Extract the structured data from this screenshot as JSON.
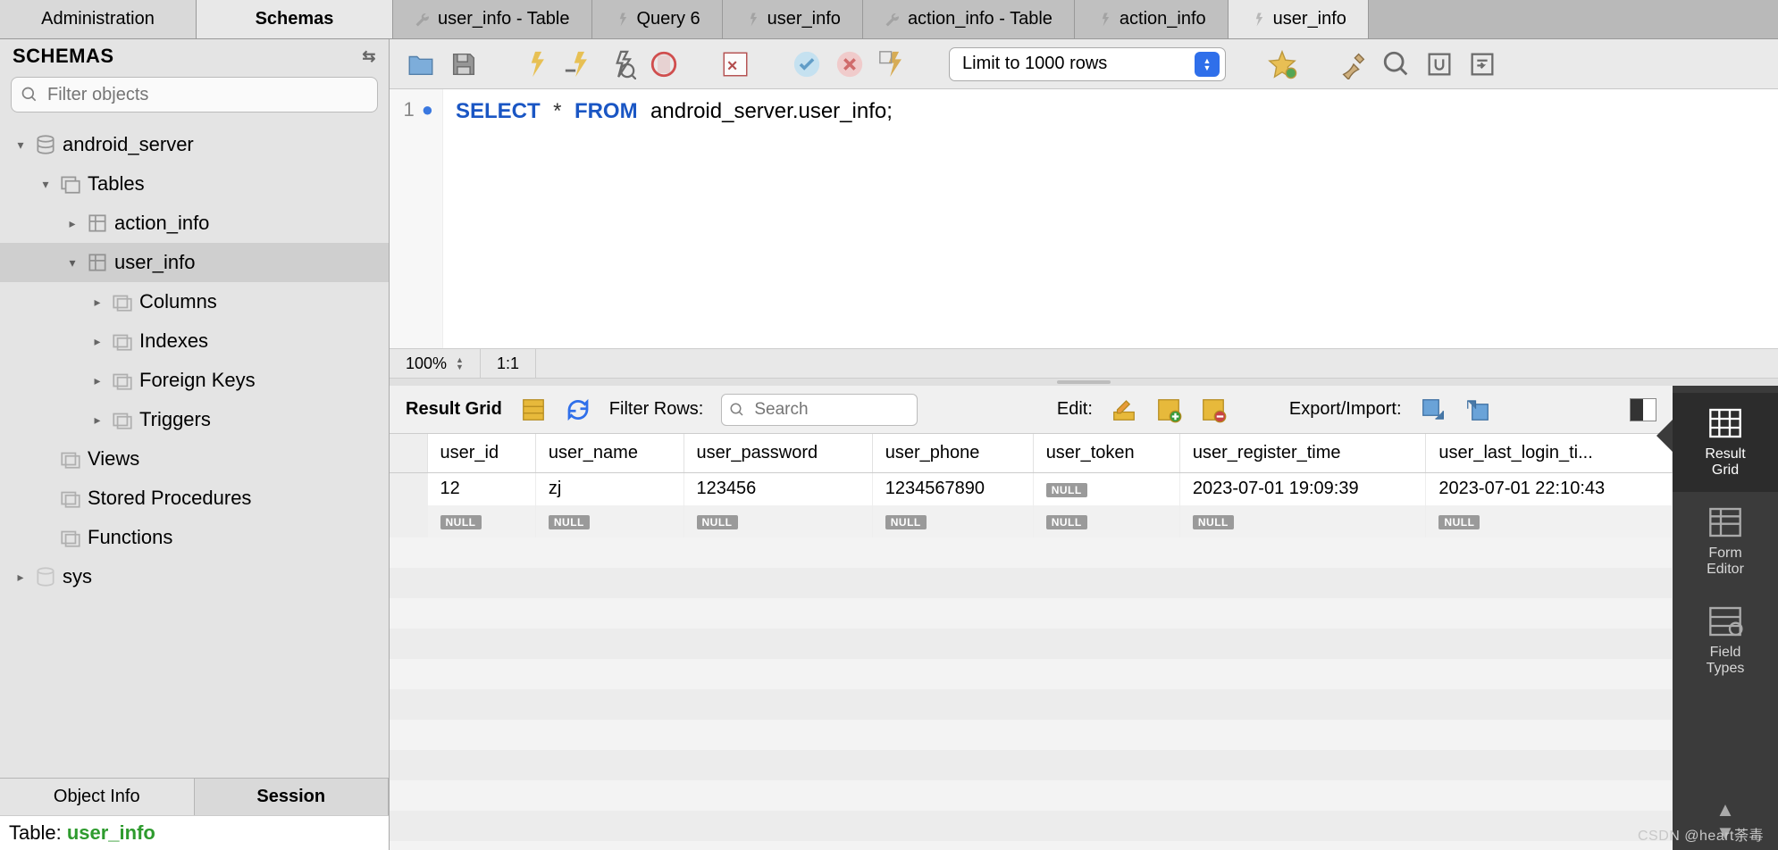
{
  "top": {
    "tabs_left": [
      "Administration",
      "Schemas"
    ],
    "active_left": 1,
    "editor_tabs": [
      {
        "icon": "wrench",
        "label": "user_info - Table"
      },
      {
        "icon": "bolt",
        "label": "Query 6"
      },
      {
        "icon": "bolt",
        "label": "user_info"
      },
      {
        "icon": "wrench",
        "label": "action_info - Table"
      },
      {
        "icon": "bolt",
        "label": "action_info"
      },
      {
        "icon": "bolt",
        "label": "user_info"
      }
    ],
    "active_editor_tab": 5
  },
  "sidebar": {
    "title": "SCHEMAS",
    "filter_placeholder": "Filter objects",
    "tree": {
      "db": "android_server",
      "tables_label": "Tables",
      "tables": [
        {
          "name": "action_info",
          "expanded": false
        },
        {
          "name": "user_info",
          "expanded": true,
          "children": [
            "Columns",
            "Indexes",
            "Foreign Keys",
            "Triggers"
          ]
        }
      ],
      "other_nodes": [
        "Views",
        "Stored Procedures",
        "Functions"
      ],
      "other_db": "sys"
    },
    "bottom_tabs": [
      "Object Info",
      "Session"
    ],
    "status_prefix": "Table: ",
    "status_table": "user_info"
  },
  "toolbar": {
    "limit_label": "Limit to 1000 rows"
  },
  "editor": {
    "line_no": "1",
    "sql_select": "SELECT",
    "sql_star": "*",
    "sql_from": "FROM",
    "sql_rest": "android_server.user_info;",
    "zoom": "100%",
    "cursor": "1:1"
  },
  "result": {
    "title": "Result Grid",
    "filter_label": "Filter Rows:",
    "search_placeholder": "Search",
    "edit_label": "Edit:",
    "export_label": "Export/Import:",
    "columns": [
      "user_id",
      "user_name",
      "user_password",
      "user_phone",
      "user_token",
      "user_register_time",
      "user_last_login_ti..."
    ],
    "rows": [
      [
        "12",
        "zj",
        "123456",
        "1234567890",
        null,
        "2023-07-01 19:09:39",
        "2023-07-01 22:10:43"
      ],
      [
        null,
        null,
        null,
        null,
        null,
        null,
        null
      ]
    ]
  },
  "panel": {
    "items": [
      "Result\nGrid",
      "Form\nEditor",
      "Field\nTypes"
    ]
  },
  "watermark": "CSDN @heart荼毒"
}
